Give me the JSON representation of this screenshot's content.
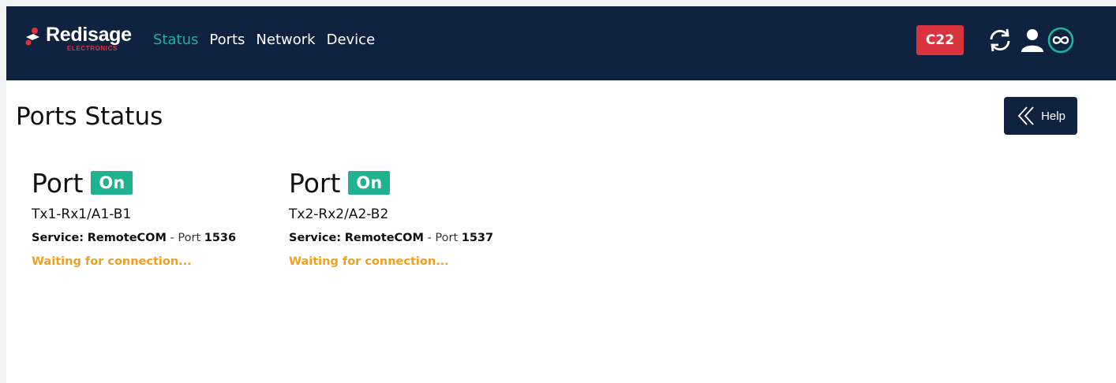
{
  "brand": {
    "name": "Redisage",
    "sub": "ELECTRONICS"
  },
  "nav": {
    "links": [
      "Status",
      "Ports",
      "Network",
      "Device"
    ],
    "active": "Status"
  },
  "header": {
    "badge": "C22"
  },
  "page": {
    "title": "Ports Status",
    "help_label": "Help"
  },
  "ports": [
    {
      "label": "Port",
      "state": "On",
      "id": "Tx1-Rx1/A1-B1",
      "service_label": "Service:",
      "service_name": "RemoteCOM",
      "sep": " - ",
      "port_word": "Port",
      "port_number": "1536",
      "status": "Waiting for connection..."
    },
    {
      "label": "Port",
      "state": "On",
      "id": "Tx2-Rx2/A2-B2",
      "service_label": "Service:",
      "service_name": "RemoteCOM",
      "sep": " - ",
      "port_word": "Port",
      "port_number": "1537",
      "status": "Waiting for connection..."
    }
  ],
  "colors": {
    "navbar": "#0f2340",
    "accent": "#1ab59b",
    "on": "#1fb28f",
    "badge": "#d9333f",
    "waiting": "#f0a020"
  },
  "icons": [
    "logo-icon",
    "sync-icon",
    "user-icon",
    "infinity-icon",
    "double-chevron-left-icon"
  ]
}
